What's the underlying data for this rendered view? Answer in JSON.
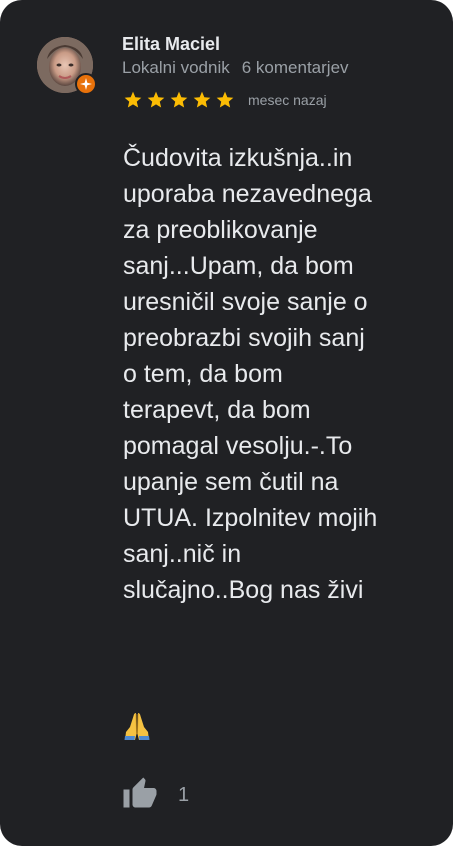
{
  "reviewer": {
    "name": "Elita Maciel",
    "role": "Lokalni vodnik",
    "reviews_count": "6 komentarjev",
    "avatar_icon": "avatar-photo",
    "badge_icon": "local-guide-badge-icon"
  },
  "rating": {
    "value": 5,
    "max": 5,
    "star_color": "#fbbc04",
    "time": "mesec nazaj"
  },
  "review": {
    "text": "Čudovita izkušnja..in\nuporaba nezavednega\nza preoblikovanje\nsanj...Upam, da bom\nuresničil svoje sanje o\npreobrazbi svojih sanj\no tem, da bom\nterapevt, da bom\npomagal vesolju.-.To\nupanje sem čutil na\nUTUA. Izpolnitev mojih\nsanj..nič in\nslučajno..Bog nas živi",
    "emoji": "🙏"
  },
  "actions": {
    "like_icon": "thumbs-up-icon",
    "like_count": "1"
  },
  "colors": {
    "card_bg": "#202124",
    "primary_text": "#e8eaed",
    "secondary_text": "#9aa0a6",
    "badge": "#e8710a"
  }
}
